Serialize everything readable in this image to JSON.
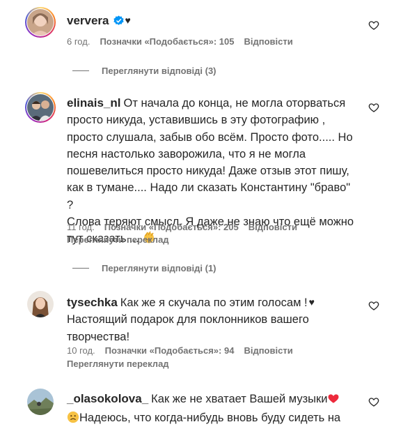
{
  "comments": [
    {
      "username": "ververa",
      "verified": true,
      "suffix": "♥",
      "text": "",
      "time": "6 год.",
      "likes": "Позначки «Подобається»: 105",
      "reply": "Відповісти",
      "view_replies": "Переглянути відповіді (3)"
    },
    {
      "username": "elinais_nl",
      "text_lines": [
        "От начала до конца, не могла оторваться",
        "просто никуда, уставившись в эту фотографию ,",
        "просто слушала, забыв обо всём. Просто фото..... Но",
        "песня настолько заворожила, что я не могла",
        "пошевелиться просто никуда! Даже отзыв этот пишу,",
        "как в тумане.... Надо ли сказать Константину \"браво\" ?",
        "Слова теряют смысл. Я даже не знаю что ещё можно",
        "тут сказать...."
      ],
      "emoji": "👏",
      "time": "11 год.",
      "likes": "Позначки «Подобається»: 205",
      "reply": "Відповісти",
      "translate": "Переглянути переклад",
      "view_replies": "Переглянути відповіді (1)"
    },
    {
      "username": "tysechka",
      "text_lines": [
        "Как же я скучала по этим голосам !",
        "Настоящий подарок для поклонников вашего",
        "творчества!"
      ],
      "suffix": "♥",
      "time": "10 год.",
      "likes": "Позначки «Подобається»: 94",
      "reply": "Відповісти",
      "translate": "Переглянути переклад"
    },
    {
      "username": "_olasokolova_",
      "text_lines": [
        "Как же не хватает Вашей музыки",
        "Надеюсь, что когда-нибудь вновь буду сидеть на"
      ],
      "emoji_heart": "❤",
      "emoji_sad": "🙁"
    }
  ],
  "colors": {
    "text": "#262626",
    "muted": "#737373",
    "verified": "#0095f6",
    "heart_red": "#ed2a3c"
  }
}
